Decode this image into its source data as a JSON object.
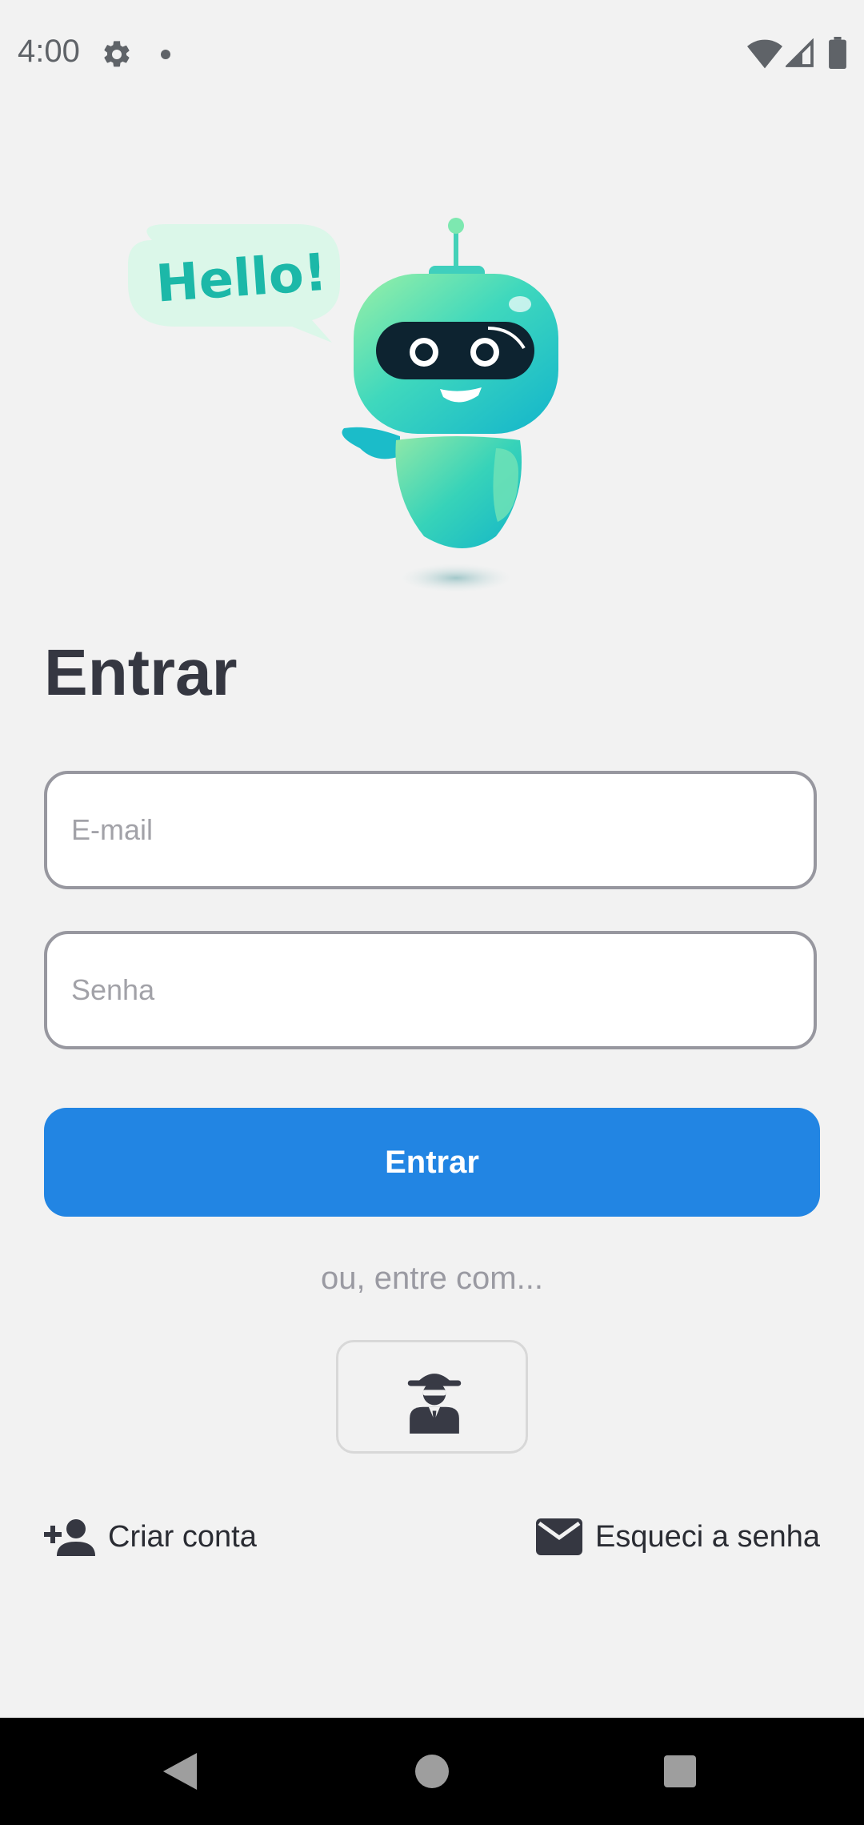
{
  "status_bar": {
    "time": "4:00",
    "icons": [
      "gear-icon",
      "notification-dot",
      "wifi-icon",
      "signal-icon",
      "battery-icon"
    ]
  },
  "illustration": {
    "speech_bubble_text": "Hello!"
  },
  "login": {
    "title": "Entrar",
    "email_placeholder": "E-mail",
    "password_placeholder": "Senha",
    "submit_label": "Entrar",
    "alt_login_text": "ou, entre com...",
    "anonymous_icon": "incognito-icon"
  },
  "links": {
    "create_account": "Criar conta",
    "forgot_password": "Esqueci a senha"
  },
  "colors": {
    "background": "#f2f2f2",
    "primary": "#2285e3",
    "title": "#353741",
    "muted": "#9a9aa2"
  }
}
